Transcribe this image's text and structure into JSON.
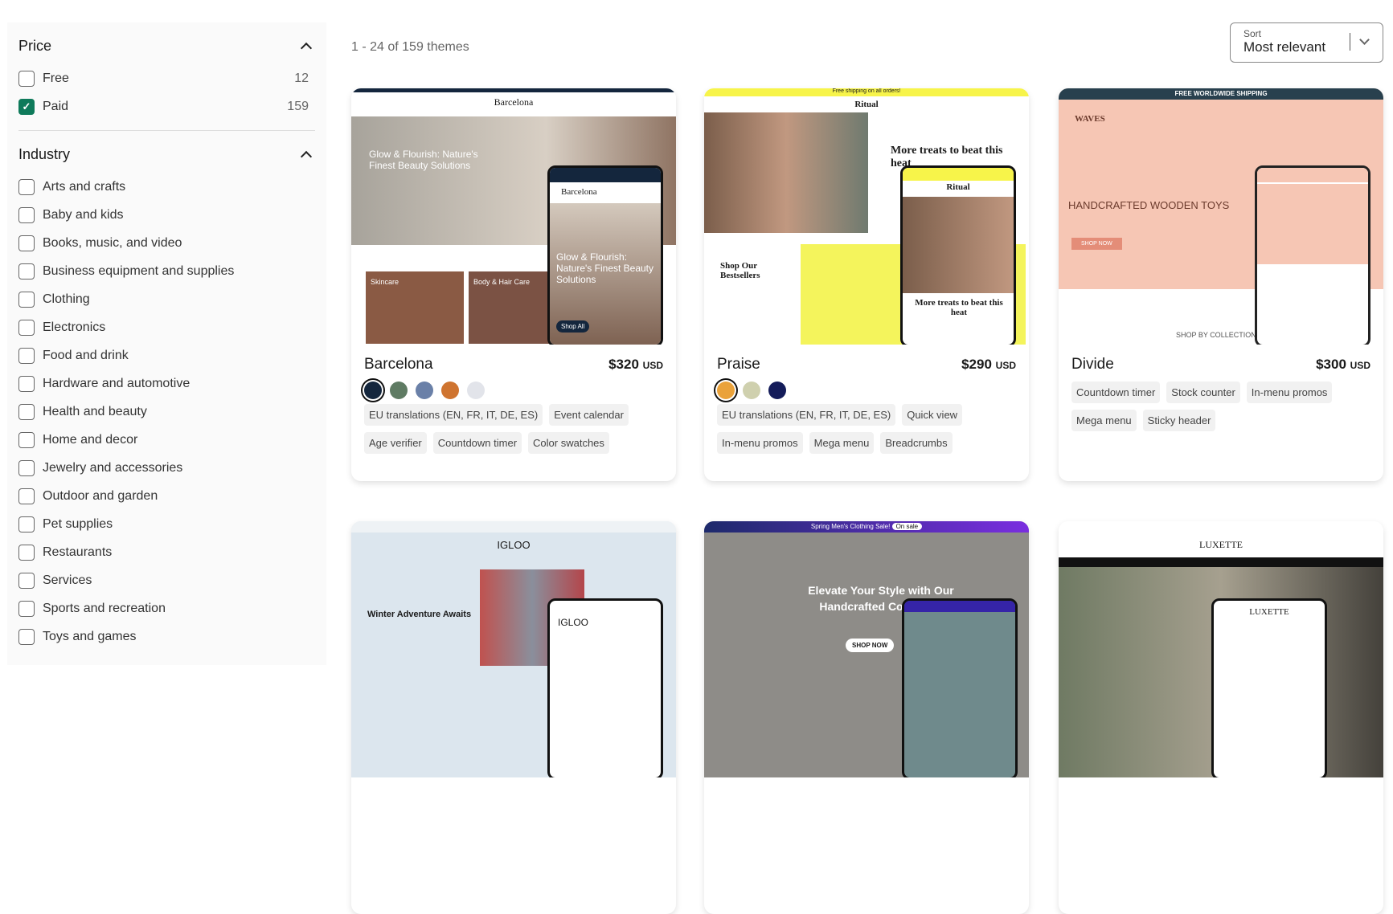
{
  "filters": {
    "price": {
      "title": "Price",
      "options": [
        {
          "label": "Free",
          "count": "12",
          "checked": false
        },
        {
          "label": "Paid",
          "count": "159",
          "checked": true
        }
      ]
    },
    "industry": {
      "title": "Industry",
      "options": [
        "Arts and crafts",
        "Baby and kids",
        "Books, music, and video",
        "Business equipment and supplies",
        "Clothing",
        "Electronics",
        "Food and drink",
        "Hardware and automotive",
        "Health and beauty",
        "Home and decor",
        "Jewelry and accessories",
        "Outdoor and garden",
        "Pet supplies",
        "Restaurants",
        "Services",
        "Sports and recreation",
        "Toys and games"
      ]
    }
  },
  "results": {
    "count_text": "1 - 24 of 159 themes"
  },
  "sort": {
    "label": "Sort",
    "value": "Most relevant"
  },
  "accent": "#0e7a5a",
  "themes": [
    {
      "name": "Barcelona",
      "price": "$320",
      "currency": "USD",
      "swatches": [
        "#14263d",
        "#5f7b63",
        "#6a80a8",
        "#cf7430",
        "#e2e4ea"
      ],
      "tags": [
        "EU translations (EN, FR, IT, DE, ES)",
        "Event calendar",
        "Age verifier",
        "Countdown timer",
        "Color swatches"
      ],
      "preview": {
        "logo": "Barcelona",
        "headline": "Glow & Flourish: Nature's Finest Beauty Solutions",
        "tile1": "Skincare",
        "tile2": "Body & Hair Care",
        "button": "Shop All"
      }
    },
    {
      "name": "Praise",
      "price": "$290",
      "currency": "USD",
      "swatches": [
        "#eaa23a",
        "#cfd0ae",
        "#141c5a"
      ],
      "tags": [
        "EU translations (EN, FR, IT, DE, ES)",
        "Quick view",
        "In-menu promos",
        "Mega menu",
        "Breadcrumbs"
      ],
      "preview": {
        "banner": "Free shipping on all orders!",
        "logo": "Ritual",
        "headline": "More treats to beat this heat",
        "sub": "Shop Our Bestsellers"
      }
    },
    {
      "name": "Divide",
      "price": "$300",
      "currency": "USD",
      "swatches": [],
      "tags": [
        "Countdown timer",
        "Stock counter",
        "In-menu promos",
        "Mega menu",
        "Sticky header"
      ],
      "preview": {
        "banner": "FREE WORLDWIDE SHIPPING",
        "logo": "WAVES",
        "headline": "HANDCRAFTED WOODEN TOYS",
        "button": "SHOP NOW",
        "sub": "SHOP BY COLLECTION"
      }
    },
    {
      "preview": {
        "logo": "IGLOO",
        "headline": "Winter Adventure Awaits"
      }
    },
    {
      "preview": {
        "banner": "Spring Men's Clothing Sale!",
        "badge": "On sale",
        "headline": "Elevate Your Style with Our Handcrafted Collection",
        "button": "SHOP NOW"
      }
    },
    {
      "preview": {
        "logo": "LUXETTE"
      }
    }
  ]
}
